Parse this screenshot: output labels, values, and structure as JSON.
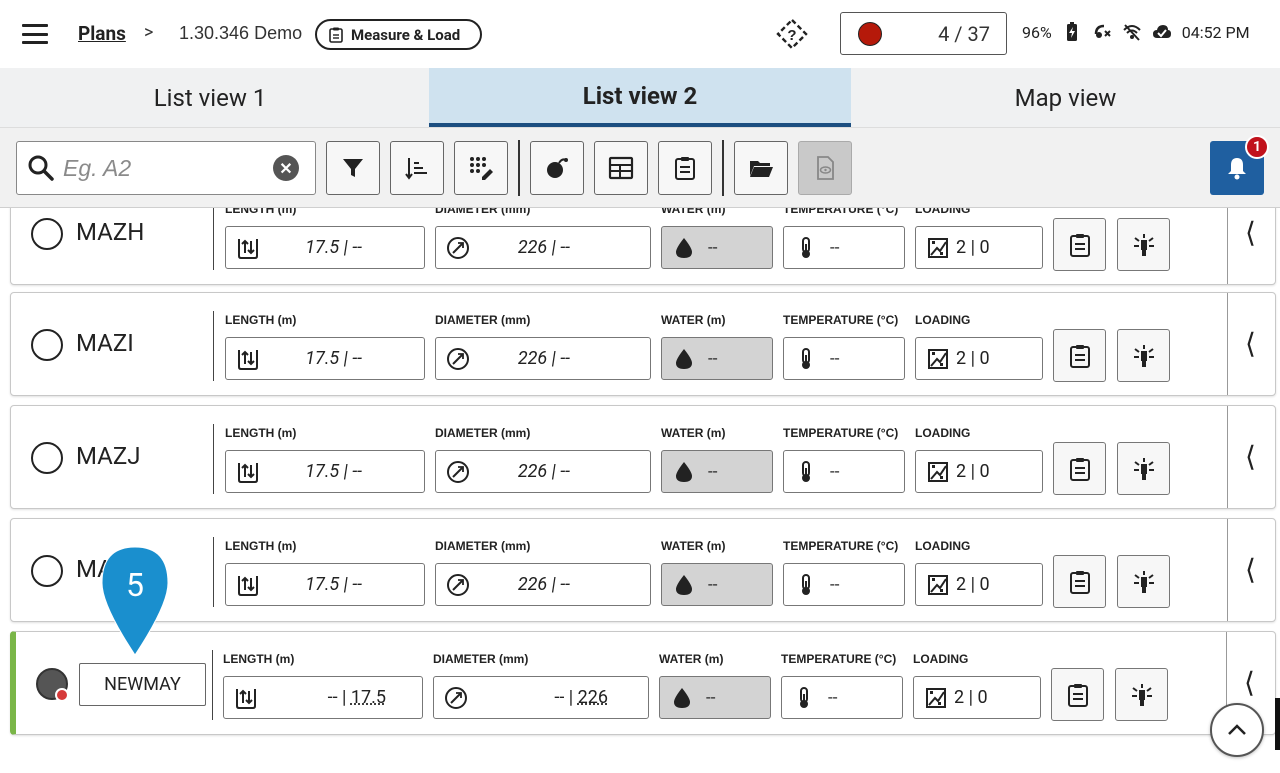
{
  "header": {
    "breadcrumb_root": "Plans",
    "breadcrumb_sep": ">",
    "version": "1.30.346 Demo",
    "mode": "Measure & Load",
    "counter": "4 / 37",
    "battery": "96%",
    "time": "04:52 PM"
  },
  "tabs": [
    {
      "label": "List view 1"
    },
    {
      "label": "List view 2"
    },
    {
      "label": "Map view"
    }
  ],
  "search": {
    "placeholder": "Eg. A2"
  },
  "notifications": {
    "count": "1"
  },
  "labels": {
    "length": "LENGTH (m)",
    "diameter": "DIAMETER (mm)",
    "water": "WATER (m)",
    "temperature": "TEMPERATURE (°C)",
    "loading": "LOADING"
  },
  "rows": [
    {
      "name": "MAZH",
      "length": "17.5 | --",
      "diameter": "226 | --",
      "water": "--",
      "temperature": "--",
      "loading": "2 | 0"
    },
    {
      "name": "MAZI",
      "length": "17.5 | --",
      "diameter": "226 | --",
      "water": "--",
      "temperature": "--",
      "loading": "2 | 0"
    },
    {
      "name": "MAZJ",
      "length": "17.5 | --",
      "diameter": "226 | --",
      "water": "--",
      "temperature": "--",
      "loading": "2 | 0"
    },
    {
      "name": "MA",
      "length": "17.5 | --",
      "diameter": "226 | --",
      "water": "--",
      "temperature": "--",
      "loading": "2 | 0"
    }
  ],
  "new_row": {
    "name": "NEWMAY",
    "length_prefix": "-- |",
    "length_value": "17.5",
    "diameter_prefix": "-- |",
    "diameter_value": "226",
    "water": "--",
    "temperature": "--",
    "loading": "2 | 0"
  },
  "marker": {
    "number": "5"
  },
  "colors": {
    "accent": "#1c4e80",
    "active_tab": "#cfe2ef",
    "bell": "#1f5fa0",
    "new_row_stripe": "#7ab648",
    "status_red": "#b5190a"
  }
}
